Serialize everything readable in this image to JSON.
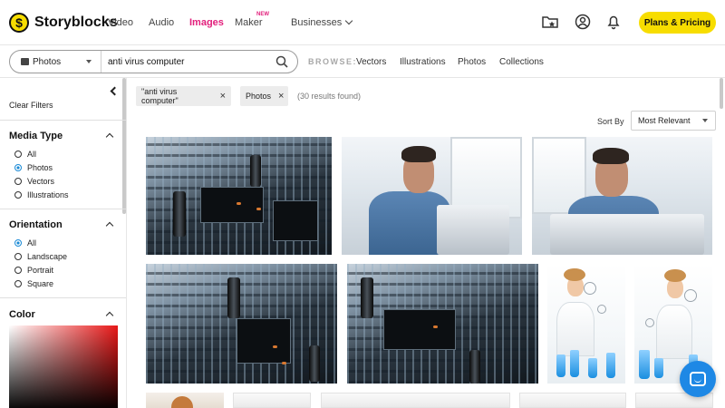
{
  "brand": {
    "logo_mark": "$",
    "name": "Storyblocks"
  },
  "nav": {
    "links": [
      "Video",
      "Audio",
      "Images",
      "Maker",
      "Businesses"
    ],
    "active": "Images",
    "maker_badge": "NEW",
    "plans_button": "Plans & Pricing",
    "icons": [
      "favorites-folder-icon",
      "account-icon",
      "notifications-bell-icon"
    ]
  },
  "search": {
    "media_type": "Photos",
    "query": "anti virus computer",
    "browse_label": "BROWSE:",
    "browse_links": [
      "Vectors",
      "Illustrations",
      "Photos",
      "Collections"
    ]
  },
  "sidebar": {
    "clear_filters": "Clear Filters",
    "media_type": {
      "title": "Media Type",
      "options": [
        "All",
        "Photos",
        "Vectors",
        "Illustrations"
      ],
      "selected": "Photos"
    },
    "orientation": {
      "title": "Orientation",
      "options": [
        "All",
        "Landscape",
        "Portrait",
        "Square"
      ],
      "selected": "All"
    },
    "color": {
      "title": "Color",
      "hue": "#e81818"
    }
  },
  "filters": {
    "chips": [
      "\"anti virus computer\"",
      "Photos"
    ],
    "chip_close": "×",
    "results": "(30 results found)"
  },
  "sort": {
    "label": "Sort By",
    "value": "Most Relevant"
  },
  "accent": {
    "pink": "#e2207c",
    "yellow": "#f7dd00",
    "blue": "#1a8ad6"
  },
  "thumbnails": [
    "circuit-board-photo",
    "man-at-laptop-photo",
    "man-at-laptop-photo",
    "circuit-board-photo",
    "circuit-board-photo",
    "scientist-lab-photo",
    "scientist-lab-photo",
    "partial-photo",
    "partial-photo",
    "partial-photo",
    "partial-photo",
    "partial-photo"
  ]
}
